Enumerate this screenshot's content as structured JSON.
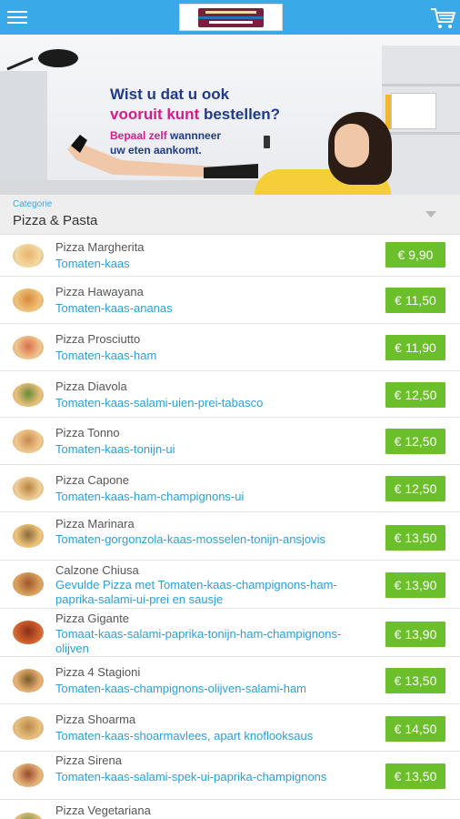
{
  "header": {
    "menu_icon": "hamburger-menu-icon",
    "logo": "restaurant-logo",
    "cart_icon": "shopping-cart-icon",
    "colors": {
      "bar": "#3aa9e8",
      "price": "#6bbf2b",
      "link": "#2b9fd8"
    }
  },
  "banner": {
    "line1": "Wist u dat u ook",
    "line2_a": "vooruit kunt",
    "line2_b": "bestellen?",
    "sub1_a": "Bepaal zelf",
    "sub1_b": "wannneer",
    "sub2": "uw eten aankomt."
  },
  "category": {
    "label": "Categorie",
    "value": "Pizza & Pasta"
  },
  "items": [
    {
      "name": "Pizza Margherita",
      "desc": "Tomaten-kaas",
      "price": "€ 9,90"
    },
    {
      "name": "Pizza Hawayana",
      "desc": "Tomaten-kaas-ananas",
      "price": "€ 11,50"
    },
    {
      "name": "Pizza Prosciutto",
      "desc": "Tomaten-kaas-ham",
      "price": "€ 11,90"
    },
    {
      "name": "Pizza Diavola",
      "desc": "Tomaten-kaas-salami-uien-prei-tabasco",
      "price": "€ 12,50"
    },
    {
      "name": "Pizza Tonno",
      "desc": "Tomaten-kaas-tonijn-ui",
      "price": "€ 12,50"
    },
    {
      "name": "Pizza Capone",
      "desc": "Tomaten-kaas-ham-champignons-ui",
      "price": "€ 12,50"
    },
    {
      "name": "Pizza Marinara",
      "desc": "Tomaten-gorgonzola-kaas-mosselen-tonijn-ansjovis",
      "price": "€ 13,50"
    },
    {
      "name": "Calzone Chiusa",
      "desc": "Gevulde Pizza met Tomaten-kaas-champignons-ham-paprika-salami-ui-prei en sausje",
      "price": "€ 13,90"
    },
    {
      "name": "Pizza Gigante",
      "desc": "Tomaat-kaas-salami-paprika-tonijn-ham-champignons-olijven",
      "price": "€ 13,90"
    },
    {
      "name": "Pizza 4 Stagioni",
      "desc": "Tomaten-kaas-champignons-olijven-salami-ham",
      "price": "€ 13,50"
    },
    {
      "name": "Pizza Shoarma",
      "desc": "Tomaten-kaas-shoarmavlees, apart knoflooksaus",
      "price": "€ 14,50"
    },
    {
      "name": "Pizza Sirena",
      "desc": "Tomaten-kaas-salami-spek-ui-paprika-champignons",
      "price": "€ 13,50"
    },
    {
      "name": "Pizza Vegetariana",
      "desc": "",
      "price": ""
    }
  ]
}
